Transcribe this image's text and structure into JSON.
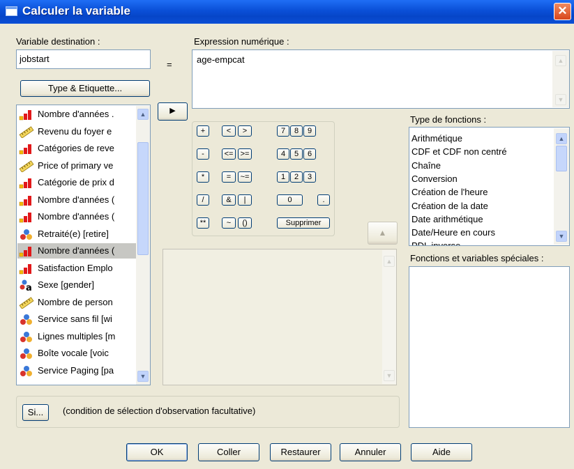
{
  "window": {
    "title": "Calculer la variable",
    "close_symbol": "✕"
  },
  "target": {
    "label": "Variable destination :",
    "value": "jobstart",
    "type_button": "Type & Etiquette..."
  },
  "equals": "=",
  "expression": {
    "label": "Expression numérique :",
    "value": "age-empcat"
  },
  "transfer_button": "▶",
  "variables": [
    {
      "icon": "scale",
      "label": "Nombre d'années ."
    },
    {
      "icon": "ruler",
      "label": "Revenu du foyer e"
    },
    {
      "icon": "scale",
      "label": "Catégories de reve"
    },
    {
      "icon": "ruler",
      "label": "Price of primary ve"
    },
    {
      "icon": "scale",
      "label": "Catégorie de prix d"
    },
    {
      "icon": "scale",
      "label": "Nombre d'années ("
    },
    {
      "icon": "scale",
      "label": "Nombre d'années ("
    },
    {
      "icon": "nominal",
      "label": "Retraité(e) [retire]"
    },
    {
      "icon": "scale",
      "label": "Nombre d'années ("
    },
    {
      "icon": "scale",
      "label": "Satisfaction Emplo"
    },
    {
      "icon": "string",
      "label": "Sexe [gender]"
    },
    {
      "icon": "ruler",
      "label": "Nombre de person"
    },
    {
      "icon": "nominal",
      "label": "Service sans fil [wi"
    },
    {
      "icon": "nominal",
      "label": "Lignes multiples [m"
    },
    {
      "icon": "nominal",
      "label": "Boîte vocale [voic"
    },
    {
      "icon": "nominal",
      "label": "Service Paging [pa"
    }
  ],
  "selected_variable_index": 8,
  "keypad": {
    "ops": [
      "+",
      "-",
      "*",
      "/",
      "**"
    ],
    "rel": [
      [
        "<",
        ">"
      ],
      [
        "<=",
        ">="
      ],
      [
        "=",
        "~="
      ],
      [
        "&",
        "|"
      ],
      [
        "~",
        "()"
      ]
    ],
    "digits": [
      [
        "7",
        "8",
        "9"
      ],
      [
        "4",
        "5",
        "6"
      ],
      [
        "1",
        "2",
        "3"
      ]
    ],
    "zero": "0",
    "dot": ".",
    "delete": "Supprimer"
  },
  "func_type": {
    "label": "Type de fonctions :",
    "items": [
      "Arithmétique",
      "CDF et CDF non centré",
      "Chaîne",
      "Conversion",
      "Création de l'heure",
      "Création de la date",
      "Date arithmétique",
      "Date/Heure en cours",
      "PDL inverse"
    ]
  },
  "special_funcs": {
    "label": "Fonctions et variables spéciales :"
  },
  "up_arrow": "▲",
  "if": {
    "button": "Si...",
    "text": "(condition de sélection d'observation facultative)"
  },
  "buttons": {
    "ok": "OK",
    "paste": "Coller",
    "reset": "Restaurer",
    "cancel": "Annuler",
    "help": "Aide"
  }
}
